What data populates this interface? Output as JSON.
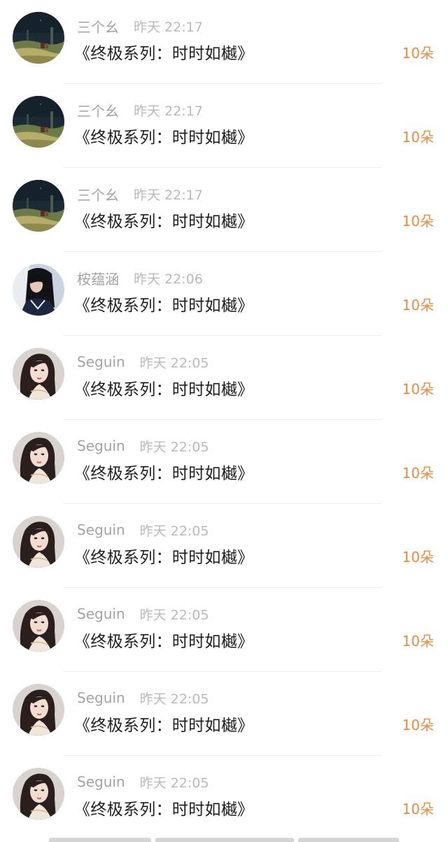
{
  "items": [
    {
      "avatar": "night-field-avatar",
      "username": "三个幺",
      "time": "昨天 22:17",
      "gift": "《终极系列：时时如樾》",
      "amount": "10朵"
    },
    {
      "avatar": "night-field-avatar",
      "username": "三个幺",
      "time": "昨天 22:17",
      "gift": "《终极系列：时时如樾》",
      "amount": "10朵"
    },
    {
      "avatar": "night-field-avatar",
      "username": "三个幺",
      "time": "昨天 22:17",
      "gift": "《终极系列：时时如樾》",
      "amount": "10朵"
    },
    {
      "avatar": "dark-hair-girl-avatar",
      "username": "桉蕴涵",
      "time": "昨天 22:06",
      "gift": "《终极系列：时时如樾》",
      "amount": "10朵"
    },
    {
      "avatar": "illustrated-woman-avatar",
      "username": "Seguin",
      "time": "昨天 22:05",
      "gift": "《终极系列：时时如樾》",
      "amount": "10朵"
    },
    {
      "avatar": "illustrated-woman-avatar",
      "username": "Seguin",
      "time": "昨天 22:05",
      "gift": "《终极系列：时时如樾》",
      "amount": "10朵"
    },
    {
      "avatar": "illustrated-woman-avatar",
      "username": "Seguin",
      "time": "昨天 22:05",
      "gift": "《终极系列：时时如樾》",
      "amount": "10朵"
    },
    {
      "avatar": "illustrated-woman-avatar",
      "username": "Seguin",
      "time": "昨天 22:05",
      "gift": "《终极系列：时时如樾》",
      "amount": "10朵"
    },
    {
      "avatar": "illustrated-woman-avatar",
      "username": "Seguin",
      "time": "昨天 22:05",
      "gift": "《终极系列：时时如樾》",
      "amount": "10朵"
    },
    {
      "avatar": "illustrated-woman-avatar",
      "username": "Seguin",
      "time": "昨天 22:05",
      "gift": "《终极系列：时时如樾》",
      "amount": "10朵"
    }
  ],
  "colors": {
    "username": "#a3a3a3",
    "time": "#b9b9b9",
    "gift": "#202020",
    "amount": "#f08a3c",
    "divider": "#eeeeee"
  }
}
